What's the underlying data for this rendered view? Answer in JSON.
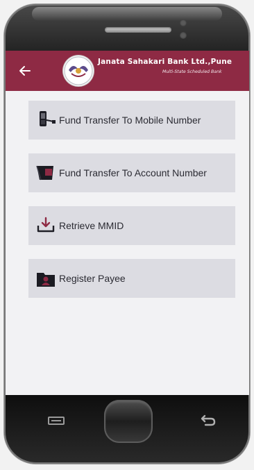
{
  "header": {
    "bank_name": "Janata Sahakari Bank Ltd.,Pune",
    "bank_subtitle": "Multi-State Scheduled Bank"
  },
  "menu": [
    {
      "label": "Fund Transfer To Mobile Number",
      "icon": "mobile-phone-icon"
    },
    {
      "label": "Fund Transfer To Account Number",
      "icon": "wallet-icon"
    },
    {
      "label": "Retrieve MMID",
      "icon": "download-tray-icon"
    },
    {
      "label": "Register Payee",
      "icon": "payee-folder-icon"
    }
  ],
  "colors": {
    "header_bg": "#8e2a44",
    "menu_item_bg": "#dcdce2",
    "screen_bg": "#f2f2f4"
  }
}
